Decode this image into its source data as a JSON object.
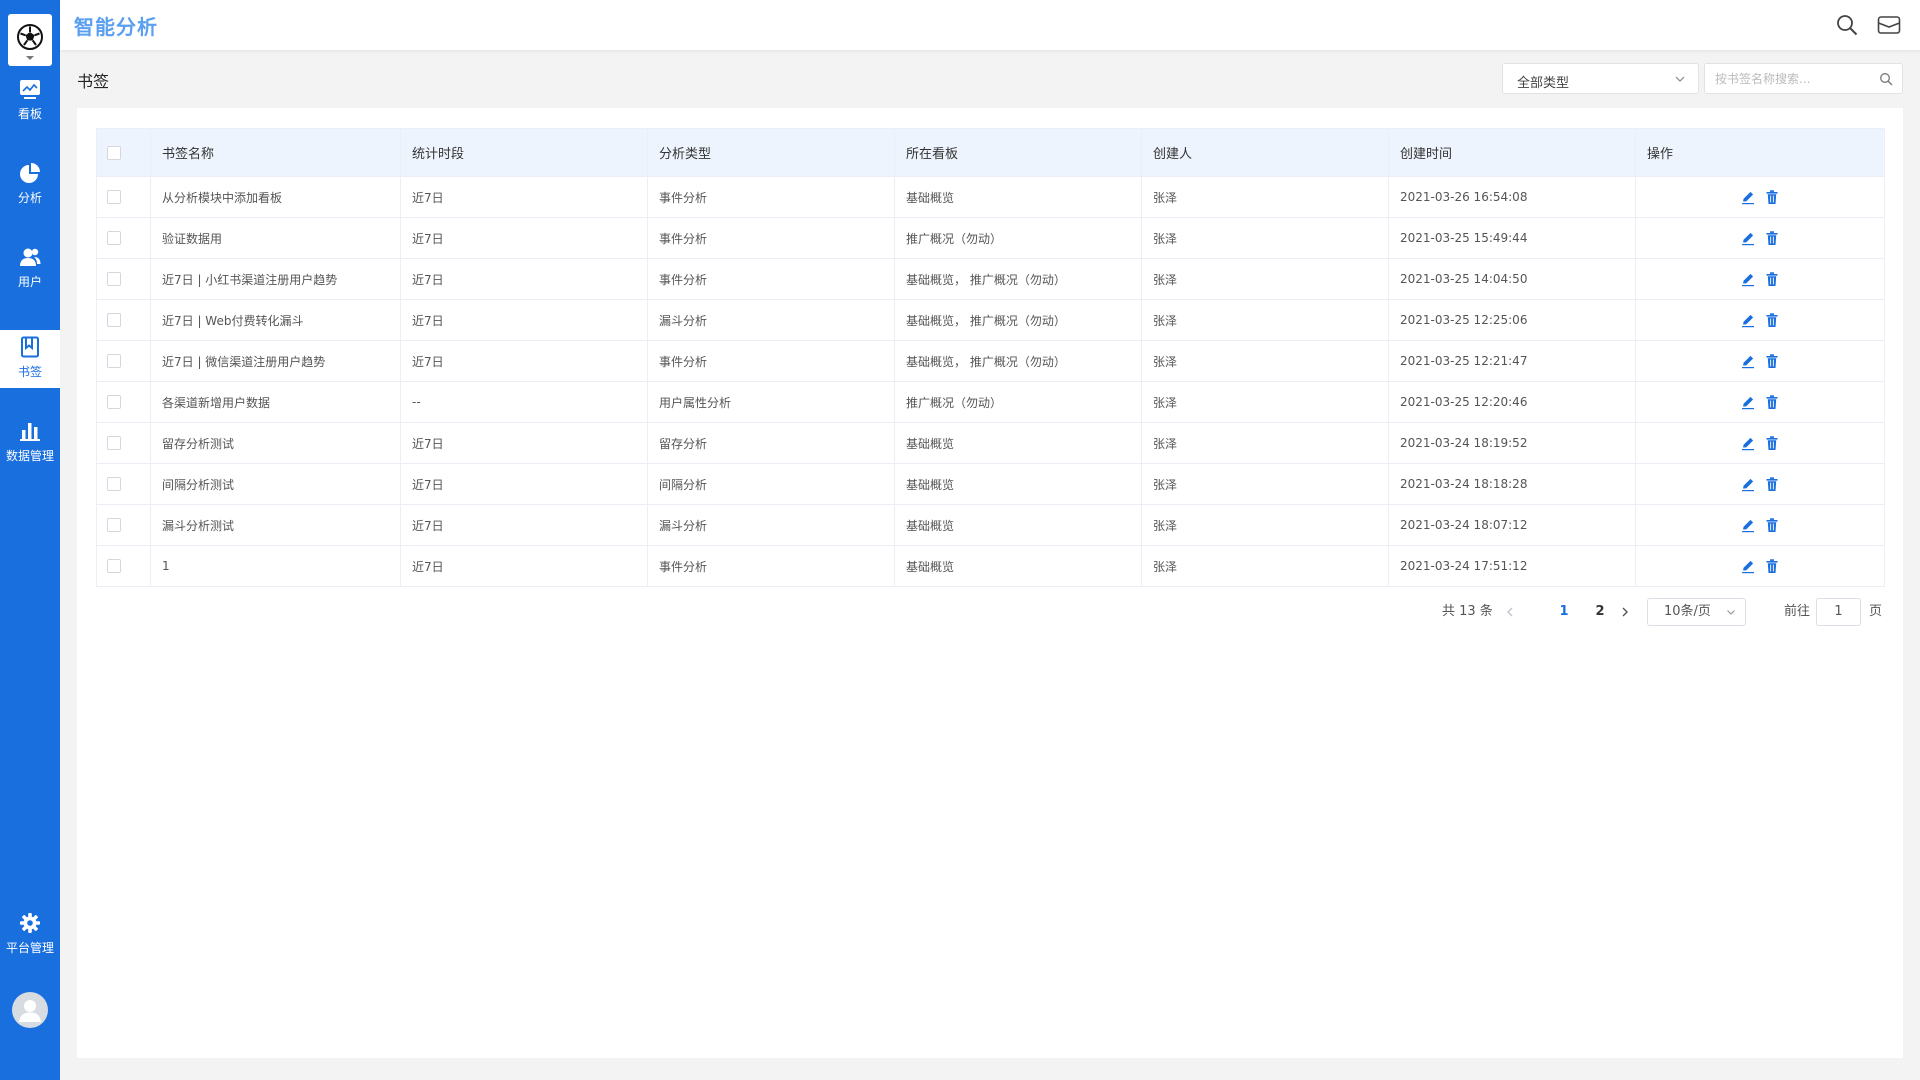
{
  "app": {
    "title": "智能分析"
  },
  "sidebar": {
    "items": [
      {
        "label": "看板",
        "icon": "dashboard-icon"
      },
      {
        "label": "分析",
        "icon": "pie-chart-icon"
      },
      {
        "label": "用户",
        "icon": "users-icon"
      },
      {
        "label": "书签",
        "icon": "bookmark-icon"
      },
      {
        "label": "数据管理",
        "icon": "bar-chart-icon"
      },
      {
        "label": "平台管理",
        "icon": "gear-icon"
      }
    ],
    "active": "书签"
  },
  "header": {
    "icons": [
      "search-icon",
      "mail-icon"
    ]
  },
  "page": {
    "title": "书签",
    "type_filter": "全部类型",
    "search_placeholder": "按书签名称搜索..."
  },
  "table": {
    "columns": [
      "书签名称",
      "统计时段",
      "分析类型",
      "所在看板",
      "创建人",
      "创建时间",
      "操作"
    ],
    "rows": [
      {
        "name": "从分析模块中添加看板",
        "period": "近7日",
        "type": "事件分析",
        "board": "基础概览",
        "creator": "张泽",
        "created": "2021-03-26 16:54:08"
      },
      {
        "name": "验证数据用",
        "period": "近7日",
        "type": "事件分析",
        "board": "推广概况（勿动）",
        "creator": "张泽",
        "created": "2021-03-25 15:49:44"
      },
      {
        "name": "近7日 | 小红书渠道注册用户趋势",
        "period": "近7日",
        "type": "事件分析",
        "board": "基础概览， 推广概况（勿动）",
        "creator": "张泽",
        "created": "2021-03-25 14:04:50"
      },
      {
        "name": "近7日 | Web付费转化漏斗",
        "period": "近7日",
        "type": "漏斗分析",
        "board": "基础概览， 推广概况（勿动）",
        "creator": "张泽",
        "created": "2021-03-25 12:25:06"
      },
      {
        "name": "近7日 | 微信渠道注册用户趋势",
        "period": "近7日",
        "type": "事件分析",
        "board": "基础概览， 推广概况（勿动）",
        "creator": "张泽",
        "created": "2021-03-25 12:21:47"
      },
      {
        "name": "各渠道新增用户数据",
        "period": "--",
        "type": "用户属性分析",
        "board": "推广概况（勿动）",
        "creator": "张泽",
        "created": "2021-03-25 12:20:46"
      },
      {
        "name": "留存分析测试",
        "period": "近7日",
        "type": "留存分析",
        "board": "基础概览",
        "creator": "张泽",
        "created": "2021-03-24 18:19:52"
      },
      {
        "name": "间隔分析测试",
        "period": "近7日",
        "type": "间隔分析",
        "board": "基础概览",
        "creator": "张泽",
        "created": "2021-03-24 18:18:28"
      },
      {
        "name": "漏斗分析测试",
        "period": "近7日",
        "type": "漏斗分析",
        "board": "基础概览",
        "creator": "张泽",
        "created": "2021-03-24 18:07:12"
      },
      {
        "name": "1",
        "period": "近7日",
        "type": "事件分析",
        "board": "基础概览",
        "creator": "张泽",
        "created": "2021-03-24 17:51:12"
      }
    ]
  },
  "pagination": {
    "total": "共 13 条",
    "pages": [
      "1",
      "2"
    ],
    "current": "1",
    "page_size": "10条/页",
    "goto_label": "前往",
    "goto_value": "1",
    "goto_unit": "页"
  },
  "colors": {
    "primary": "#1a6fde",
    "title": "#5a9ff0",
    "header_row": "#eef4fd"
  }
}
